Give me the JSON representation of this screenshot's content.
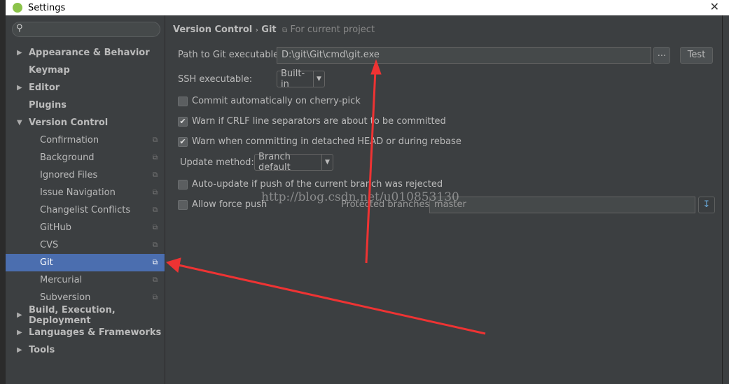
{
  "window": {
    "title": "Settings",
    "close": "✕"
  },
  "sidebar": {
    "search_placeholder": "",
    "items": [
      {
        "label": "Appearance & Behavior",
        "level": 0,
        "arrow": "▶"
      },
      {
        "label": "Keymap",
        "level": 0
      },
      {
        "label": "Editor",
        "level": 0,
        "arrow": "▶"
      },
      {
        "label": "Plugins",
        "level": 0
      },
      {
        "label": "Version Control",
        "level": 0,
        "arrow": "▼"
      },
      {
        "label": "Confirmation",
        "level": 1
      },
      {
        "label": "Background",
        "level": 1
      },
      {
        "label": "Ignored Files",
        "level": 1
      },
      {
        "label": "Issue Navigation",
        "level": 1
      },
      {
        "label": "Changelist Conflicts",
        "level": 1
      },
      {
        "label": "GitHub",
        "level": 1
      },
      {
        "label": "CVS",
        "level": 1
      },
      {
        "label": "Git",
        "level": 1,
        "selected": true
      },
      {
        "label": "Mercurial",
        "level": 1
      },
      {
        "label": "Subversion",
        "level": 1
      },
      {
        "label": "Build, Execution, Deployment",
        "level": 0,
        "arrow": "▶"
      },
      {
        "label": "Languages & Frameworks",
        "level": 0,
        "arrow": "▶"
      },
      {
        "label": "Tools",
        "level": 0,
        "arrow": "▶"
      }
    ]
  },
  "main": {
    "breadcrumb": {
      "parent": "Version Control",
      "sep": "›",
      "current": "Git",
      "scope": "For current project"
    },
    "path_label": "Path to Git executable:",
    "path_value": "D:\\git\\Git\\cmd\\git.exe",
    "browse": "...",
    "test": "Test",
    "ssh_label": "SSH executable:",
    "ssh_value": "Built-in",
    "commit_auto": {
      "label": "Commit automatically on cherry-pick",
      "checked": false
    },
    "warn_crlf": {
      "label": "Warn if CRLF line separators are about to be committed",
      "checked": true
    },
    "warn_detached": {
      "label": "Warn when committing in detached HEAD or during rebase",
      "checked": true
    },
    "update_label": "Update method:",
    "update_value": "Branch default",
    "auto_update": {
      "label": "Auto-update if push of the current branch was rejected",
      "checked": false
    },
    "force_push": {
      "label": "Allow force push",
      "checked": false
    },
    "protected_label": "Protected branches:",
    "protected_value": "master"
  },
  "watermark": "http://blog.csdn.net/u010853130",
  "colors": {
    "selection": "#4b6eaf",
    "annotation_arrow": "#ee3333"
  }
}
